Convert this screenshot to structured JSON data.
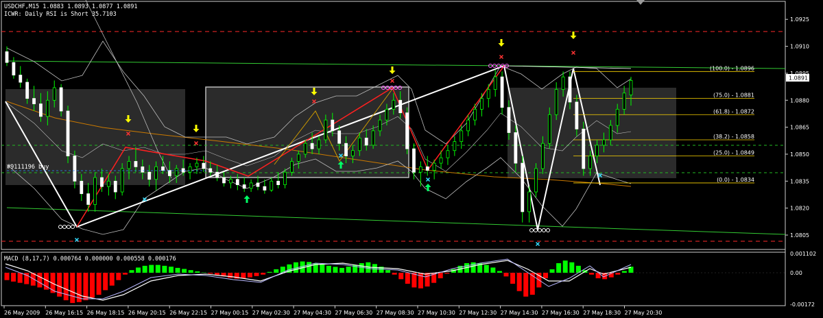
{
  "header": {
    "symbol_line": "USDCHF,M15  1.0883 1.0893 1.0877 1.0891",
    "indicator_line": "ICWR: Daily RSI is Short 35.7103"
  },
  "trade_label": "#9111196 buy",
  "price_axis": {
    "ticks": [
      "1.0925",
      "1.0910",
      "1.0895",
      "1.0880",
      "1.0865",
      "1.0850",
      "1.0835",
      "1.0820",
      "1.0805"
    ],
    "current_price": "1.0891"
  },
  "time_axis": {
    "labels": [
      "26 May 2009",
      "26 May 16:15",
      "26 May 18:15",
      "26 May 20:15",
      "26 May 22:15",
      "27 May 00:15",
      "27 May 02:30",
      "27 May 04:30",
      "27 May 06:30",
      "27 May 08:30",
      "27 May 10:30",
      "27 May 12:30",
      "27 May 14:30",
      "27 May 16:30",
      "27 May 18:30",
      "27 May 20:30"
    ]
  },
  "fibonacci_levels": [
    {
      "label": "(100.0) - 1.0896",
      "price": 1.0896
    },
    {
      "label": "(75.0) - 1.0881",
      "price": 1.0881
    },
    {
      "label": "(61.8) - 1.0872",
      "price": 1.0872
    },
    {
      "label": "(38.2) - 1.0858",
      "price": 1.0858
    },
    {
      "label": "(25.0) - 1.0849",
      "price": 1.0849
    },
    {
      "label": "(0.0) - 1.0834",
      "price": 1.0834
    }
  ],
  "macd": {
    "label": "MACD (8,17,7) 0.000764 0.000000 0.000558 0.000176",
    "ticks": [
      "0.001102",
      "0.00",
      "-0.00172"
    ],
    "max": 0.001102,
    "min": -0.00172
  },
  "colors": {
    "bull": "#00ff00",
    "bear": "#ffffff",
    "wick": "#00ff00",
    "macd_pos": "#00ff00",
    "macd_neg": "#ff0000",
    "fib": "#ffd700",
    "zigzag": "#ff0000",
    "trend": "#ffffff",
    "arrow_down": "#ffff00",
    "arrow_up": "#00ff66",
    "cross_red": "#ff3333",
    "cross_cyan": "#33ddff",
    "pivot_circle": "#ff66ff",
    "ma": "#cc7a00"
  },
  "chart_data": {
    "type": "candlestick",
    "symbol": "USDCHF",
    "timeframe": "M15",
    "ylim": [
      1.0797,
      1.0935
    ],
    "candles_ohlc": [
      [
        1.0907,
        1.091,
        1.0899,
        1.0901
      ],
      [
        1.0901,
        1.0904,
        1.0892,
        1.0894
      ],
      [
        1.0894,
        1.0899,
        1.0887,
        1.089
      ],
      [
        1.089,
        1.0892,
        1.0878,
        1.0881
      ],
      [
        1.0881,
        1.0888,
        1.0874,
        1.0878
      ],
      [
        1.0878,
        1.0884,
        1.0868,
        1.0871
      ],
      [
        1.0871,
        1.0885,
        1.0866,
        1.088
      ],
      [
        1.088,
        1.0891,
        1.0876,
        1.0887
      ],
      [
        1.0887,
        1.0889,
        1.0871,
        1.0874
      ],
      [
        1.0874,
        1.0877,
        1.0845,
        1.0849
      ],
      [
        1.0849,
        1.0852,
        1.0831,
        1.0835
      ],
      [
        1.0835,
        1.0839,
        1.0824,
        1.0828
      ],
      [
        1.0828,
        1.0834,
        1.0818,
        1.0822
      ],
      [
        1.0822,
        1.084,
        1.0818,
        1.0837
      ],
      [
        1.0837,
        1.0842,
        1.0829,
        1.0832
      ],
      [
        1.0832,
        1.0839,
        1.0827,
        1.0835
      ],
      [
        1.0835,
        1.0838,
        1.0825,
        1.0829
      ],
      [
        1.0829,
        1.0845,
        1.0827,
        1.0842
      ],
      [
        1.0842,
        1.0849,
        1.0836,
        1.0846
      ],
      [
        1.0846,
        1.0854,
        1.084,
        1.0843
      ],
      [
        1.0843,
        1.0847,
        1.0836,
        1.084
      ],
      [
        1.084,
        1.0844,
        1.0832,
        1.0836
      ],
      [
        1.0836,
        1.0846,
        1.083,
        1.0843
      ],
      [
        1.0843,
        1.0849,
        1.0839,
        1.0841
      ],
      [
        1.0841,
        1.0846,
        1.0834,
        1.0838
      ],
      [
        1.0838,
        1.0844,
        1.0834,
        1.0842
      ],
      [
        1.0842,
        1.0847,
        1.0838,
        1.084
      ],
      [
        1.084,
        1.0845,
        1.0836,
        1.0843
      ],
      [
        1.0843,
        1.0848,
        1.0839,
        1.0845
      ],
      [
        1.0845,
        1.0849,
        1.084,
        1.0842
      ],
      [
        1.0842,
        1.0846,
        1.0838,
        1.084
      ],
      [
        1.084,
        1.0844,
        1.0835,
        1.0837
      ],
      [
        1.0837,
        1.084,
        1.0832,
        1.0834
      ],
      [
        1.0834,
        1.0838,
        1.0831,
        1.0836
      ],
      [
        1.0836,
        1.0839,
        1.083,
        1.0833
      ],
      [
        1.0833,
        1.0837,
        1.0829,
        1.0831
      ],
      [
        1.0831,
        1.0836,
        1.0829,
        1.0834
      ],
      [
        1.0834,
        1.0838,
        1.083,
        1.0832
      ],
      [
        1.0832,
        1.0836,
        1.0828,
        1.083
      ],
      [
        1.083,
        1.0837,
        1.0829,
        1.0835
      ],
      [
        1.0835,
        1.084,
        1.0831,
        1.0833
      ],
      [
        1.0833,
        1.0842,
        1.0831,
        1.084
      ],
      [
        1.084,
        1.0848,
        1.0838,
        1.0846
      ],
      [
        1.0846,
        1.0852,
        1.0842,
        1.085
      ],
      [
        1.085,
        1.0858,
        1.0848,
        1.0856
      ],
      [
        1.0856,
        1.0862,
        1.085,
        1.0853
      ],
      [
        1.0853,
        1.086,
        1.085,
        1.0858
      ],
      [
        1.0858,
        1.0872,
        1.0856,
        1.0869
      ],
      [
        1.0869,
        1.0873,
        1.086,
        1.0863
      ],
      [
        1.0863,
        1.0866,
        1.0852,
        1.0856
      ],
      [
        1.0856,
        1.086,
        1.0845,
        1.0849
      ],
      [
        1.0849,
        1.0855,
        1.0845,
        1.0852
      ],
      [
        1.0852,
        1.0862,
        1.0849,
        1.0859
      ],
      [
        1.0859,
        1.0864,
        1.0852,
        1.0855
      ],
      [
        1.0855,
        1.0866,
        1.0853,
        1.0863
      ],
      [
        1.0863,
        1.0872,
        1.086,
        1.0869
      ],
      [
        1.0869,
        1.0878,
        1.0866,
        1.0875
      ],
      [
        1.0875,
        1.0884,
        1.0872,
        1.088
      ],
      [
        1.088,
        1.0885,
        1.087,
        1.0873
      ],
      [
        1.0873,
        1.0876,
        1.085,
        1.0853
      ],
      [
        1.0853,
        1.0856,
        1.0836,
        1.084
      ],
      [
        1.084,
        1.0846,
        1.0832,
        1.0843
      ],
      [
        1.0843,
        1.0849,
        1.0838,
        1.0841
      ],
      [
        1.0841,
        1.0847,
        1.0836,
        1.0845
      ],
      [
        1.0845,
        1.0852,
        1.0842,
        1.0848
      ],
      [
        1.0848,
        1.0855,
        1.0844,
        1.0852
      ],
      [
        1.0852,
        1.086,
        1.0849,
        1.0857
      ],
      [
        1.0857,
        1.0866,
        1.0853,
        1.0863
      ],
      [
        1.0863,
        1.0872,
        1.086,
        1.0869
      ],
      [
        1.0869,
        1.0878,
        1.0866,
        1.0875
      ],
      [
        1.0875,
        1.0884,
        1.0871,
        1.0881
      ],
      [
        1.0881,
        1.0889,
        1.0876,
        1.0886
      ],
      [
        1.0886,
        1.0897,
        1.0882,
        1.0893
      ],
      [
        1.0893,
        1.0896,
        1.0872,
        1.0876
      ],
      [
        1.0876,
        1.088,
        1.0858,
        1.0862
      ],
      [
        1.0862,
        1.0866,
        1.084,
        1.0845
      ],
      [
        1.0845,
        1.0849,
        1.0812,
        1.0818
      ],
      [
        1.0818,
        1.0832,
        1.0812,
        1.0829
      ],
      [
        1.0829,
        1.0845,
        1.0826,
        1.0842
      ],
      [
        1.0842,
        1.086,
        1.0839,
        1.0856
      ],
      [
        1.0856,
        1.0876,
        1.0853,
        1.0872
      ],
      [
        1.0872,
        1.089,
        1.0869,
        1.0886
      ],
      [
        1.0886,
        1.0896,
        1.0882,
        1.0893
      ],
      [
        1.0893,
        1.0896,
        1.0875,
        1.0879
      ],
      [
        1.0879,
        1.0883,
        1.086,
        1.0864
      ],
      [
        1.0864,
        1.0868,
        1.0838,
        1.0842
      ],
      [
        1.0842,
        1.0852,
        1.0838,
        1.0849
      ],
      [
        1.0849,
        1.0858,
        1.0845,
        1.0855
      ],
      [
        1.0855,
        1.0862,
        1.0851,
        1.0858
      ],
      [
        1.0858,
        1.0869,
        1.0855,
        1.0866
      ],
      [
        1.0866,
        1.0878,
        1.0862,
        1.0875
      ],
      [
        1.0875,
        1.0888,
        1.0872,
        1.0884
      ],
      [
        1.0883,
        1.0893,
        1.0877,
        1.0891
      ]
    ],
    "macd_histogram": [
      -0.0004,
      -0.00048,
      -0.00055,
      -0.00062,
      -0.0007,
      -0.0008,
      -0.00092,
      -0.0011,
      -0.0013,
      -0.0015,
      -0.00165,
      -0.0016,
      -0.0015,
      -0.00135,
      -0.0012,
      -0.00095,
      -0.0007,
      -0.0004,
      -0.0001,
      0.00015,
      0.0003,
      0.0004,
      0.00045,
      0.00045,
      0.0004,
      0.00035,
      0.00028,
      0.00022,
      0.00015,
      8e-05,
      2e-05,
      -5e-05,
      -0.00012,
      -0.0002,
      -0.00028,
      -0.00032,
      -0.0003,
      -0.00025,
      -0.00018,
      -0.0001,
      5e-05,
      0.0002,
      0.00035,
      0.00048,
      0.0006,
      0.00065,
      0.00062,
      0.00055,
      0.00048,
      0.0004,
      0.00034,
      0.00028,
      0.00035,
      0.00045,
      0.00055,
      0.0006,
      0.0005,
      0.00035,
      0.00015,
      -0.0001,
      -0.00035,
      -0.0006,
      -0.0008,
      -0.00085,
      -0.00075,
      -0.00055,
      -0.0003,
      -5e-05,
      0.0002,
      0.0004,
      0.00055,
      0.0006,
      0.00055,
      0.00045,
      0.0003,
      0.0001,
      -0.0002,
      -0.0006,
      -0.001,
      -0.0013,
      -0.0012,
      -0.0008,
      -0.0003,
      0.0002,
      0.00055,
      0.0007,
      0.0006,
      0.0004,
      0.00015,
      -0.0001,
      -0.0003,
      -0.00035,
      -0.00025,
      -0.0001,
      0.0001,
      0.00035
    ]
  }
}
